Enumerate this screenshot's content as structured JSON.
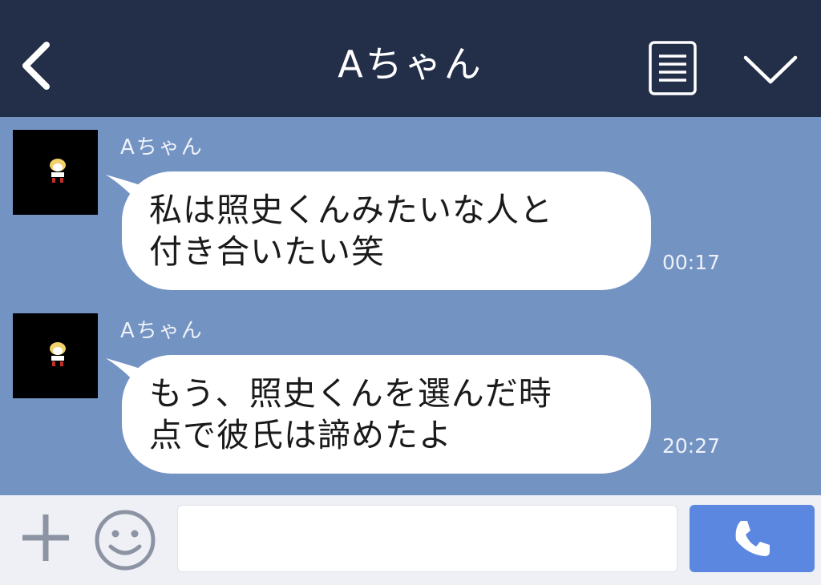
{
  "header": {
    "title": "Aちゃん",
    "back_icon": "chevron-left-icon",
    "menu_icon": "menu-list-icon",
    "collapse_icon": "chevron-down-icon"
  },
  "messages": [
    {
      "sender": "Aちゃん",
      "text": "私は照史くんみたいな人と\n付き合いたい笑",
      "time": "00:17"
    },
    {
      "sender": "Aちゃん",
      "text": "もう、照史くんを選んだ時\n点で彼氏は諦めたよ",
      "time": "20:27"
    }
  ],
  "input_bar": {
    "plus_icon": "plus-icon",
    "emoji_icon": "smiley-icon",
    "input_value": "",
    "call_icon": "phone-icon"
  },
  "colors": {
    "header_bg": "#232e48",
    "chat_bg": "#7393c3",
    "bubble_bg": "#ffffff",
    "input_bar_bg": "#eef0f6",
    "call_button_bg": "#5b87e0"
  }
}
